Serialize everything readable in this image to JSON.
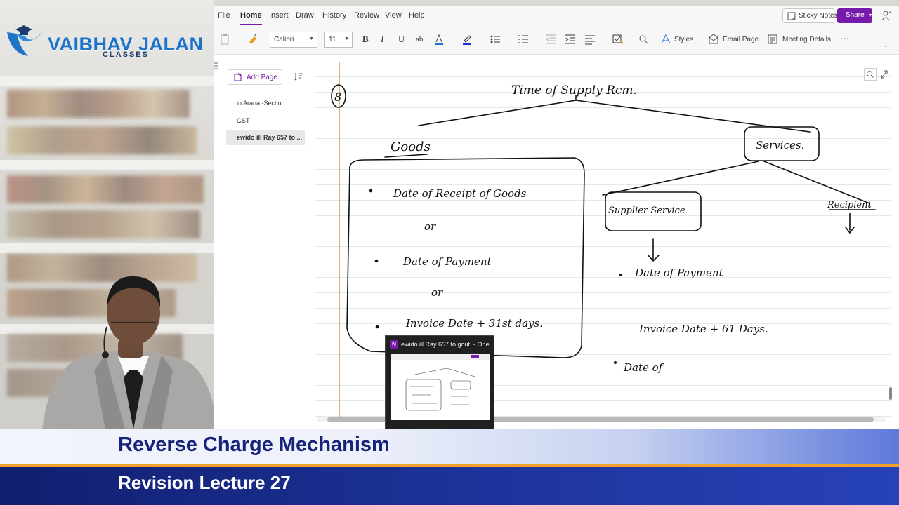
{
  "branding": {
    "logo_text": "VAIBHAV JALAN",
    "logo_subtext": "CLASSES"
  },
  "menubar": {
    "items": [
      "File",
      "Home",
      "Insert",
      "Draw",
      "History",
      "Review",
      "View",
      "Help"
    ],
    "active": "Home",
    "sticky_notes": "Sticky Notes",
    "share": "Share"
  },
  "ribbon": {
    "font": "Calibri",
    "size": "11",
    "styles": "Styles",
    "email_page": "Email Page",
    "meeting_details": "Meeting Details",
    "more": "···"
  },
  "pagelist": {
    "add_page": "Add Page",
    "pages": [
      "in Arana -Section",
      "GST",
      "ewido ill Ray 657 to ..."
    ],
    "selected_index": 2
  },
  "notes": {
    "heading": "Time of Supply Rcm.",
    "number": "8",
    "goods": "Goods",
    "services": "Services.",
    "goods_points": [
      "Date of Receipt of Goods",
      "Date of Payment",
      "Invoice Date + 31st days."
    ],
    "or_marks": [
      "or",
      "or"
    ],
    "supplier_service": "Supplier Service",
    "recipient": "Recipient",
    "service_points": [
      "Date of Payment",
      "Invoice Date + 61 Days.",
      "Date of"
    ]
  },
  "taskbar_preview": {
    "title": "ewido ill Ray 657 to gout. - One...",
    "icon": "N"
  },
  "lower_third": {
    "title": "Reverse Charge Mechanism",
    "subtitle": "Revision Lecture 27"
  },
  "colors": {
    "accent": "#7719aa",
    "banner_blue": "#2742b8",
    "banner_stripe": "#f2a12a",
    "title_navy": "#16237a"
  }
}
